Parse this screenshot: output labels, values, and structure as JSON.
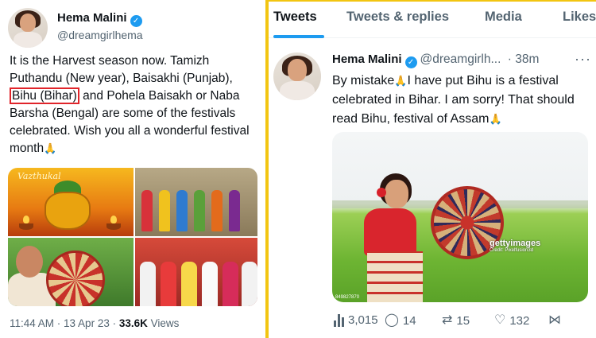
{
  "left_tweet": {
    "author_name": "Hema Malini",
    "author_handle": "@dreamgirlhema",
    "text_part1": "It is the Harvest season now. Tamizh Puthandu (New year), Baisakhi (Punjab), ",
    "text_highlight": "Bihu (Bihar)",
    "text_part2": " and Pohela Baisakh or Naba Barsha (Bengal) are some of the festivals celebrated. Wish you all a wonderful festival month",
    "text_emoji": "🙏",
    "image_caption_text": "Vazthukal",
    "meta_time": "11:44 AM · 13 Apr 23 · ",
    "meta_views_count": "33.6K",
    "meta_views_label": " Views"
  },
  "right_tweet": {
    "tabs": [
      "Tweets",
      "Tweets & replies",
      "Media",
      "Likes"
    ],
    "active_tab": "Tweets",
    "author_name": "Hema Malini",
    "author_handle": "@dreamgirlh...",
    "time": "· 38m",
    "more_icon": "···",
    "text_part1": "By mistake",
    "text_emoji": "🙏",
    "text_part2": "I have put Bihu is a festival celebrated in Bihar. I am sorry! That should read Bihu, festival of Assam",
    "photo_watermark": "gettyimages",
    "photo_credit": "Credit: Pixelfusion3d",
    "photo_code": "849827870",
    "views": "3,015",
    "replies": "14",
    "retweets": "15",
    "likes": "132"
  },
  "colors": {
    "accent": "#1d9bf0",
    "divider": "#f2c511",
    "highlight_box": "#e0242a"
  }
}
